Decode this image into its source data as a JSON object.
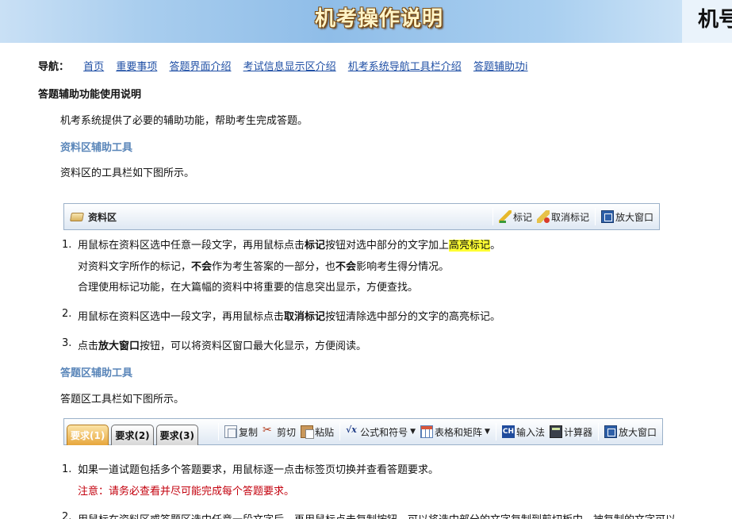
{
  "banner": {
    "title": "机考操作说明",
    "right_text": "机号"
  },
  "nav": {
    "label": "导航：",
    "links": [
      "首页",
      "重要事项",
      "答题界面介绍",
      "考试信息显示区介绍",
      "机考系统导航工具栏介绍",
      "答题辅助功i"
    ]
  },
  "section_title": "答题辅助功能使用说明",
  "intro": "机考系统提供了必要的辅助功能，帮助考生完成答题。",
  "resource": {
    "subtitle": "资料区辅助工具",
    "desc": "资料区的工具栏如下图所示。",
    "toolbar": {
      "title": "资料区",
      "buttons": [
        {
          "label": "标记",
          "icon": "highlighter-pen-icon"
        },
        {
          "label": "取消标记",
          "icon": "eraser-pen-icon"
        },
        {
          "label": "放大窗口",
          "icon": "maximize-window-icon"
        }
      ]
    },
    "steps": [
      {
        "num": "1.",
        "l1_a": "用鼠标在资料区选中任意一段文字，再用鼠标点击",
        "l1_kw": "标记",
        "l1_b": "按钮对选中部分的文字加上",
        "l1_hl": "高亮标记",
        "l1_c": "。",
        "l2_a": "对资料文字所作的标记，",
        "l2_kw1": "不会",
        "l2_b": "作为考生答案的一部分，也",
        "l2_kw2": "不会",
        "l2_c": "影响考生得分情况。",
        "l3": "合理使用标记功能，在大篇幅的资料中将重要的信息突出显示，方便查找。"
      },
      {
        "num": "2.",
        "a": "用鼠标在资料区选中一段文字，再用鼠标点击",
        "kw": "取消标记",
        "b": "按钮清除选中部分的文字的高亮标记。"
      },
      {
        "num": "3.",
        "a": "点击",
        "kw": "放大窗口",
        "b": "按钮，可以将资料区窗口最大化显示，方便阅读。"
      }
    ]
  },
  "answer": {
    "subtitle": "答题区辅助工具",
    "desc": "答题区工具栏如下图所示。",
    "tabs": [
      "要求(1)",
      "要求(2)",
      "要求(3)"
    ],
    "buttons": [
      {
        "label": "复制",
        "icon": "copy-icon"
      },
      {
        "label": "剪切",
        "icon": "scissors-icon"
      },
      {
        "label": "粘贴",
        "icon": "paste-icon"
      },
      {
        "label": "公式和符号",
        "icon": "formula-icon"
      },
      {
        "label": "表格和矩阵",
        "icon": "table-icon"
      },
      {
        "label": "输入法",
        "icon": "input-method-icon"
      },
      {
        "label": "计算器",
        "icon": "calculator-icon"
      },
      {
        "label": "放大窗口",
        "icon": "maximize-window-icon"
      }
    ],
    "steps": [
      {
        "num": "1.",
        "line": "如果一道试题包括多个答题要求，用鼠标逐一点击标签页切换并查看答题要求。",
        "note": "注意：请务必查看并尽可能完成每个答题要求。"
      },
      {
        "num": "2.",
        "partial": "用鼠标在资料区或答题区选中任意一段文字后，再用鼠标点击复制按钮，可以将选中部分的文字复制到剪切板中，被复制的文字可以"
      }
    ]
  }
}
